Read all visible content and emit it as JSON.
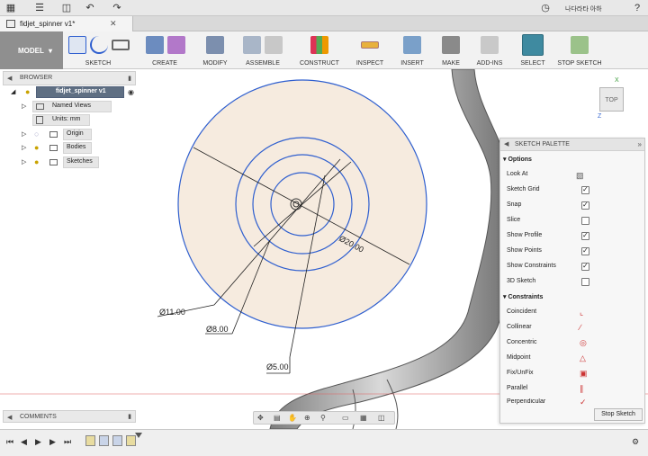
{
  "app": {
    "document_tab": "fidjet_spinner v1*",
    "user_name": "나다라타 아하"
  },
  "toolbar": {
    "workspace": "MODEL",
    "groups": [
      "SKETCH",
      "CREATE",
      "MODIFY",
      "ASSEMBLE",
      "CONSTRUCT",
      "INSPECT",
      "INSERT",
      "MAKE",
      "ADD-INS",
      "SELECT",
      "STOP SKETCH"
    ]
  },
  "browser": {
    "title": "BROWSER",
    "root": "fidjet_spinner v1",
    "items": [
      "Named Views",
      "Units: mm",
      "Origin",
      "Bodies",
      "Sketches"
    ]
  },
  "comments": {
    "title": "COMMENTS"
  },
  "viewcube": {
    "face": "TOP",
    "axis_x": "X",
    "axis_z": "Z"
  },
  "sketch": {
    "dimensions": [
      "Ø11.00",
      "Ø8.00",
      "Ø5.00",
      "Ø20.00"
    ],
    "circle_color": "#2f5fcf",
    "fill_color": "#f6ebdf"
  },
  "palette": {
    "title": "SKETCH PALETTE",
    "options_header": "Options",
    "options": [
      {
        "label": "Look At",
        "type": "button"
      },
      {
        "label": "Sketch Grid",
        "checked": true
      },
      {
        "label": "Snap",
        "checked": true
      },
      {
        "label": "Slice",
        "checked": false
      },
      {
        "label": "Show Profile",
        "checked": true
      },
      {
        "label": "Show Points",
        "checked": true
      },
      {
        "label": "Show Constraints",
        "checked": true
      },
      {
        "label": "3D Sketch",
        "checked": false
      }
    ],
    "constraints_header": "Constraints",
    "constraints": [
      "Coincident",
      "Collinear",
      "Concentric",
      "Midpoint",
      "Fix/UnFix",
      "Parallel",
      "Perpendicular"
    ],
    "stop_button": "Stop Sketch"
  }
}
